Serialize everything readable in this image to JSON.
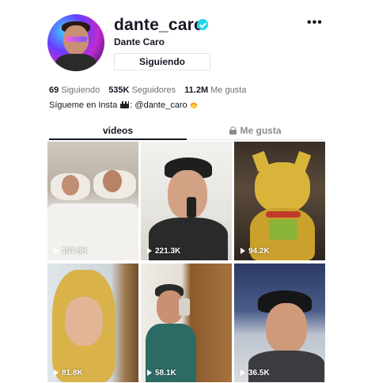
{
  "profile": {
    "username": "dante_caro",
    "display_name": "Dante Caro",
    "follow_button_label": "Siguiendo",
    "more_label": "•••",
    "verified": true
  },
  "stats": [
    {
      "value": "69",
      "label": "Siguiendo"
    },
    {
      "value": "535K",
      "label": "Seguidores"
    },
    {
      "value": "11.2M",
      "label": "Me gusta"
    }
  ],
  "bio": {
    "text_before": "Sígueme en Insta",
    "text_after": ": @dante_caro"
  },
  "tabs": [
    {
      "label": "videos",
      "active": true
    },
    {
      "label": "Me gusta",
      "active": false,
      "icon": "lock-icon"
    }
  ],
  "videos": [
    {
      "views": "157.8K"
    },
    {
      "views": "221.3K"
    },
    {
      "views": "94.2K"
    },
    {
      "views": "81.8K"
    },
    {
      "views": "58.1K"
    },
    {
      "views": "36.5K"
    }
  ],
  "colors": {
    "verified": "#20d5ec",
    "text": "#161823",
    "muted": "#6e6f76",
    "border": "#e3e3e4"
  }
}
